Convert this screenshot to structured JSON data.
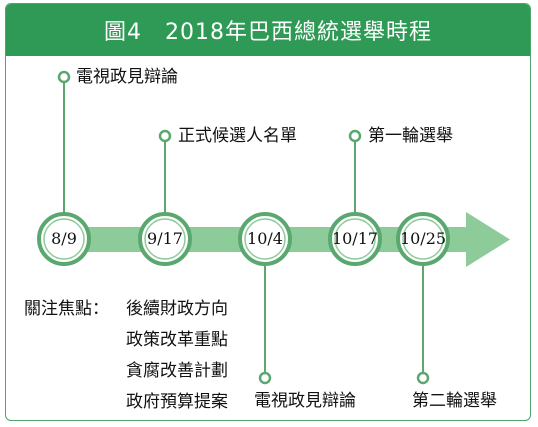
{
  "title": "圖4　2018年巴西總統選舉時程",
  "timeline": [
    {
      "date": "8/9"
    },
    {
      "date": "9/17"
    },
    {
      "date": "10/4"
    },
    {
      "date": "10/17"
    },
    {
      "date": "10/25"
    }
  ],
  "events": {
    "debate_1": "電視政見辯論",
    "candidate_list": "正式候選人名單",
    "round_1": "第一輪選舉",
    "debate_2": "電視政見辯論",
    "round_2": "第二輪選舉"
  },
  "focus": {
    "heading": "關注焦點：",
    "items": [
      "後續財政方向",
      "政策改革重點",
      "貪腐改善計劃",
      "政府預算提案"
    ]
  },
  "colors": {
    "title_bg": "#2f9a55",
    "arrow": "#8dcb9a",
    "ring": "#5aa86f"
  }
}
